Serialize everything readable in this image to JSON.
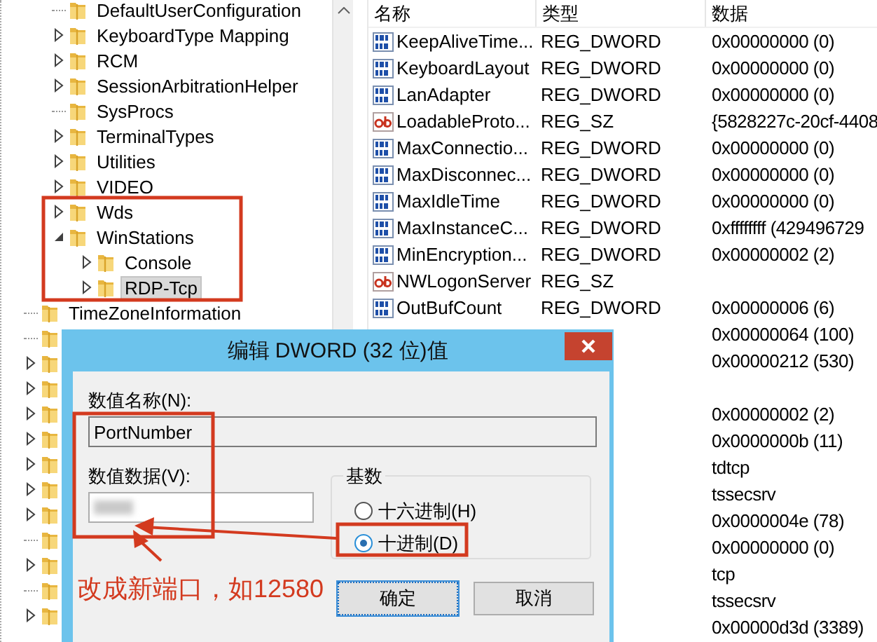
{
  "tree": {
    "items": [
      {
        "children": [
          {
            "label": "DefaultUserConfiguration",
            "expandable": false,
            "expanded": false,
            "selected": false
          },
          {
            "label": "KeyboardType Mapping",
            "expandable": true,
            "expanded": false,
            "selected": false
          },
          {
            "label": "RCM",
            "expandable": true,
            "expanded": false,
            "selected": false
          },
          {
            "label": "SessionArbitrationHelper",
            "expandable": true,
            "expanded": false,
            "selected": false
          },
          {
            "label": "SysProcs",
            "expandable": false,
            "expanded": false,
            "selected": false
          },
          {
            "label": "TerminalTypes",
            "expandable": true,
            "expanded": false,
            "selected": false
          },
          {
            "label": "Utilities",
            "expandable": true,
            "expanded": false,
            "selected": false
          },
          {
            "label": "VIDEO",
            "expandable": true,
            "expanded": false,
            "selected": false
          },
          {
            "label": "Wds",
            "expandable": true,
            "expanded": false,
            "selected": false
          },
          {
            "label": "WinStations",
            "expandable": true,
            "expanded": true,
            "selected": false,
            "children": [
              {
                "label": "Console",
                "expandable": true,
                "expanded": false,
                "selected": false
              },
              {
                "label": "RDP-Tcp",
                "expandable": true,
                "expanded": false,
                "selected": true
              }
            ]
          }
        ]
      },
      {
        "label": "TimeZoneInformation",
        "expandable": false,
        "expanded": false,
        "selected": false
      },
      {
        "expandable": false,
        "expanded": false
      },
      {
        "expandable": true,
        "expanded": false
      },
      {
        "expandable": true,
        "expanded": false
      },
      {
        "expandable": true,
        "expanded": false
      },
      {
        "expandable": true,
        "expanded": false
      },
      {
        "expandable": true,
        "expanded": false
      },
      {
        "expandable": true,
        "expanded": false
      },
      {
        "expandable": true,
        "expanded": false
      },
      {
        "expandable": false,
        "expanded": false
      },
      {
        "expandable": true,
        "expanded": false
      },
      {
        "expandable": false,
        "expanded": false
      },
      {
        "expandable": true,
        "expanded": false
      }
    ]
  },
  "list": {
    "columns": [
      "名称",
      "类型",
      "数据"
    ],
    "rows": [
      {
        "kind": "dword",
        "name": "KeepAliveTime...",
        "type": "REG_DWORD",
        "data": "0x00000000 (0)"
      },
      {
        "kind": "dword",
        "name": "KeyboardLayout",
        "type": "REG_DWORD",
        "data": "0x00000000 (0)"
      },
      {
        "kind": "dword",
        "name": "LanAdapter",
        "type": "REG_DWORD",
        "data": "0x00000000 (0)"
      },
      {
        "kind": "sz",
        "name": "LoadableProto...",
        "type": "REG_SZ",
        "data": "{5828227c-20cf-4408"
      },
      {
        "kind": "dword",
        "name": "MaxConnectio...",
        "type": "REG_DWORD",
        "data": "0x00000000 (0)"
      },
      {
        "kind": "dword",
        "name": "MaxDisconnec...",
        "type": "REG_DWORD",
        "data": "0x00000000 (0)"
      },
      {
        "kind": "dword",
        "name": "MaxIdleTime",
        "type": "REG_DWORD",
        "data": "0x00000000 (0)"
      },
      {
        "kind": "dword",
        "name": "MaxInstanceC...",
        "type": "REG_DWORD",
        "data": "0xffffffff (429496729"
      },
      {
        "kind": "dword",
        "name": "MinEncryption...",
        "type": "REG_DWORD",
        "data": "0x00000002 (2)"
      },
      {
        "kind": "sz",
        "name": "NWLogonServer",
        "type": "REG_SZ"
      },
      {
        "kind": "dword",
        "name": "OutBufCount",
        "type": "REG_DWORD",
        "data": "0x00000006 (6)"
      },
      {
        "data": "0x00000064 (100)"
      },
      {
        "data": "0x00000212 (530)"
      },
      {},
      {
        "data": "0x00000002 (2)"
      },
      {
        "data": "0x0000000b (11)"
      },
      {
        "data": "tdtcp"
      },
      {
        "data": "tssecsrv"
      },
      {
        "data": "0x0000004e (78)"
      },
      {
        "data": "0x00000000 (0)"
      },
      {
        "data": "tcp"
      },
      {
        "data": "tssecsrv"
      },
      {
        "data": "0x00000d3d (3389)"
      }
    ]
  },
  "dialog": {
    "title": "编辑 DWORD (32 位)值",
    "name_label": "数值名称(N):",
    "name_value": "PortNumber",
    "data_label": "数值数据(V):",
    "base": {
      "label": "基数",
      "options": [
        {
          "label": "十六进制(H)",
          "selected": false
        },
        {
          "label": "十进制(D)",
          "selected": true
        }
      ]
    },
    "buttons": [
      "确定",
      "取消"
    ]
  },
  "annotation": {
    "note": "改成新端口，如12580"
  }
}
